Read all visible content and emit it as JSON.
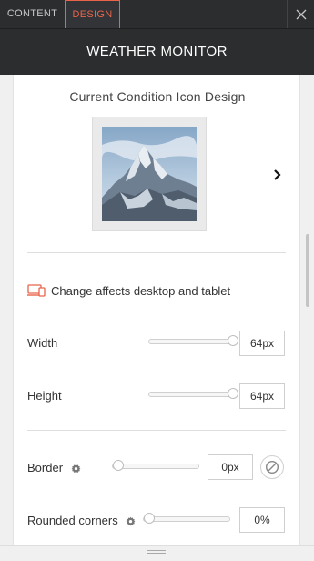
{
  "tabs": [
    {
      "label": "CONTENT",
      "active": false
    },
    {
      "label": "DESIGN",
      "active": true
    }
  ],
  "header": {
    "title": "WEATHER MONITOR"
  },
  "icon_design": {
    "title": "Current Condition Icon Design",
    "thumbnail": "mountain-image"
  },
  "notice": {
    "text": "Change affects desktop and tablet",
    "icon": "devices-icon"
  },
  "settings": {
    "width": {
      "label": "Width",
      "value": "64px",
      "level": 1.0
    },
    "height": {
      "label": "Height",
      "value": "64px",
      "level": 1.0
    },
    "border": {
      "label": "Border",
      "value": "0px",
      "level": 0.0
    },
    "rounded": {
      "label": "Rounded corners",
      "value": "0%",
      "level": 0.0
    }
  },
  "colors": {
    "accent": "#e8634a",
    "header_bg": "#2b2d2f"
  }
}
